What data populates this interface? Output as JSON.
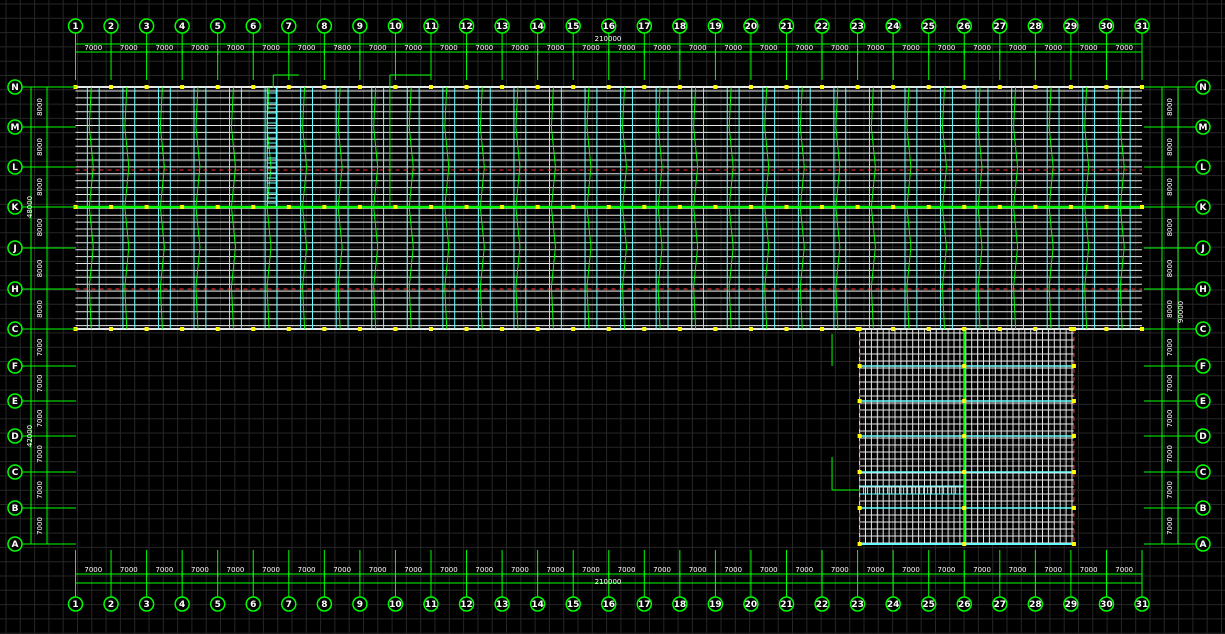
{
  "drawing": {
    "column_axes": [
      "1",
      "2",
      "3",
      "4",
      "5",
      "6",
      "7",
      "8",
      "9",
      "10",
      "11",
      "12",
      "13",
      "14",
      "15",
      "16",
      "17",
      "18",
      "19",
      "20",
      "21",
      "22",
      "23",
      "24",
      "25",
      "26",
      "27",
      "28",
      "29",
      "30",
      "31"
    ],
    "row_axes": [
      "N",
      "M",
      "L",
      "K",
      "J",
      "H",
      "G",
      "F",
      "E",
      "D",
      "C",
      "B",
      "A"
    ],
    "top_span_dims": [
      "7000",
      "7000",
      "7000",
      "7000",
      "7000",
      "7000",
      "7000",
      "7800",
      "7000",
      "7000",
      "7000",
      "7000",
      "7000",
      "7000",
      "7000",
      "7000",
      "7000",
      "7000",
      "7000",
      "7000",
      "7000",
      "7000",
      "7000",
      "7000",
      "7000",
      "7000",
      "7000",
      "7000",
      "7000",
      "7000"
    ],
    "bottom_span_dims": [
      "7000",
      "7000",
      "7000",
      "7000",
      "7000",
      "7000",
      "7000",
      "7000",
      "7000",
      "7000",
      "7000",
      "7000",
      "7000",
      "7000",
      "7000",
      "7000",
      "7000",
      "7000",
      "7000",
      "7000",
      "7000",
      "7000",
      "7000",
      "7000",
      "7000",
      "7000",
      "7000",
      "7000",
      "7000",
      "7000"
    ],
    "total_width_dim": "210000",
    "left_upper_dims": [
      "8000",
      "8000",
      "8000",
      "8000",
      "8000",
      "8000"
    ],
    "left_upper_total": "48000",
    "left_lower_dims": [
      "7000",
      "7000",
      "7000",
      "7000",
      "7000",
      "7000"
    ],
    "left_lower_total": "42000",
    "right_upper_dims": [
      "8000",
      "8000",
      "8000",
      "8000",
      "8000",
      "8000"
    ],
    "right_total": "90000",
    "right_lower_dims": [
      "7000",
      "7000",
      "7000",
      "7000",
      "7000",
      "7000"
    ],
    "colors": {
      "background": "#000000",
      "grid": "#262626",
      "axis_line": "#00ff00",
      "bubble": "#00ff00",
      "text": "#ffffff",
      "purlin": "#e8e8e8",
      "beam": "#66ffff",
      "rafter": "#00ff00",
      "column": "#ffff00",
      "dash": "#ff3030"
    }
  }
}
